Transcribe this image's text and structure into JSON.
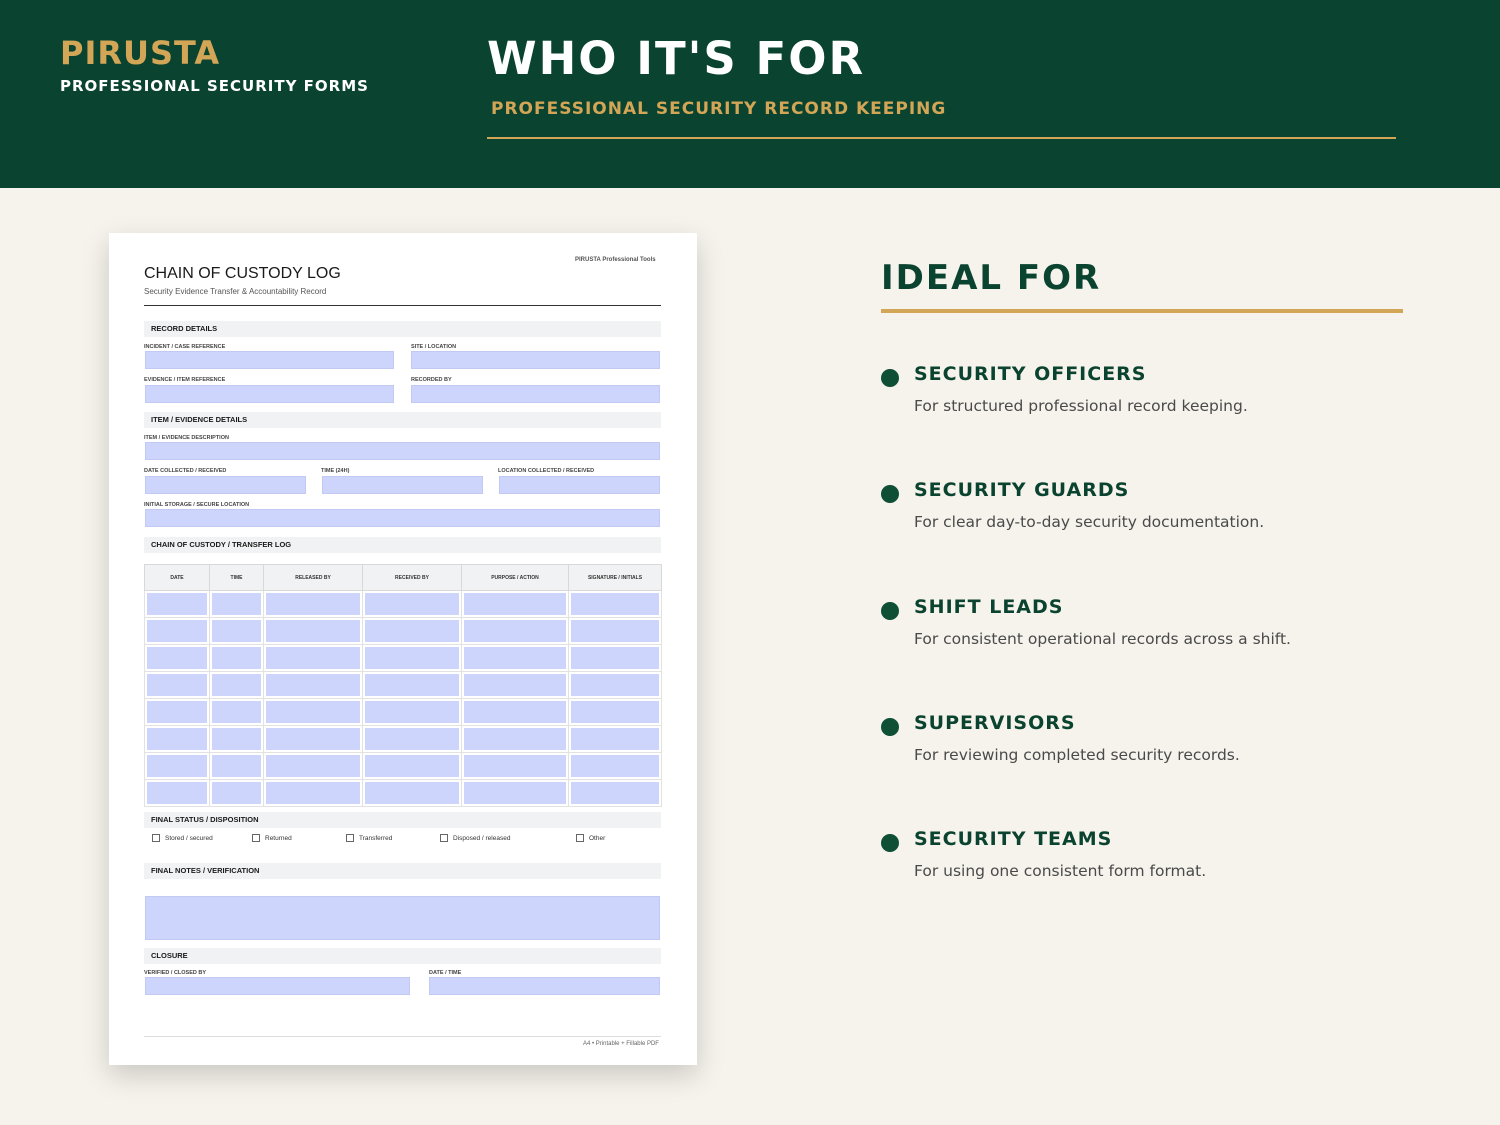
{
  "header": {
    "brand": "PIRUSTA",
    "brand_sub": "PROFESSIONAL SECURITY FORMS",
    "title": "WHO IT'S FOR",
    "subtitle": "PROFESSIONAL SECURITY RECORD KEEPING"
  },
  "document": {
    "title": "CHAIN OF CUSTODY LOG",
    "subtitle": "Security Evidence Transfer & Accountability Record",
    "brand": "PIRUSTA Professional Tools",
    "sections": {
      "record": "RECORD DETAILS",
      "item": "ITEM / EVIDENCE DETAILS",
      "log": "CHAIN OF CUSTODY / TRANSFER LOG",
      "status": "FINAL STATUS / DISPOSITION",
      "notes": "FINAL NOTES / VERIFICATION",
      "closure": "CLOSURE"
    },
    "labels": {
      "incident": "INCIDENT / CASE REFERENCE",
      "site": "SITE / LOCATION",
      "evidence_ref": "EVIDENCE / ITEM REFERENCE",
      "recorded_by": "RECORDED BY",
      "description": "ITEM / EVIDENCE DESCRIPTION",
      "date_collected": "DATE COLLECTED / RECEIVED",
      "time": "TIME (24H)",
      "location_collected": "LOCATION COLLECTED / RECEIVED",
      "storage": "INITIAL STORAGE / SECURE LOCATION",
      "verified_by": "VERIFIED / CLOSED BY",
      "date_time": "DATE / TIME"
    },
    "table_headers": [
      "DATE",
      "TIME",
      "RELEASED BY",
      "RECEIVED BY",
      "PURPOSE / ACTION",
      "SIGNATURE / INITIALS"
    ],
    "checkboxes": [
      "Stored / secured",
      "Returned",
      "Transferred",
      "Disposed / released",
      "Other"
    ],
    "footer": "A4 • Printable + Fillable PDF"
  },
  "ideal": {
    "title": "IDEAL FOR",
    "items": [
      {
        "title": "SECURITY OFFICERS",
        "desc": "For structured professional record keeping."
      },
      {
        "title": "SECURITY GUARDS",
        "desc": "For clear day-to-day security documentation."
      },
      {
        "title": "SHIFT LEADS",
        "desc": "For consistent operational records across a shift."
      },
      {
        "title": "SUPERVISORS",
        "desc": "For reviewing completed security records."
      },
      {
        "title": "SECURITY TEAMS",
        "desc": "For using one consistent form format."
      }
    ]
  },
  "colors": {
    "header_bg": "#0a432f",
    "accent_gold": "#d2a656",
    "page_bg": "#f6f3ec",
    "field_fill": "#cdd5fc"
  }
}
